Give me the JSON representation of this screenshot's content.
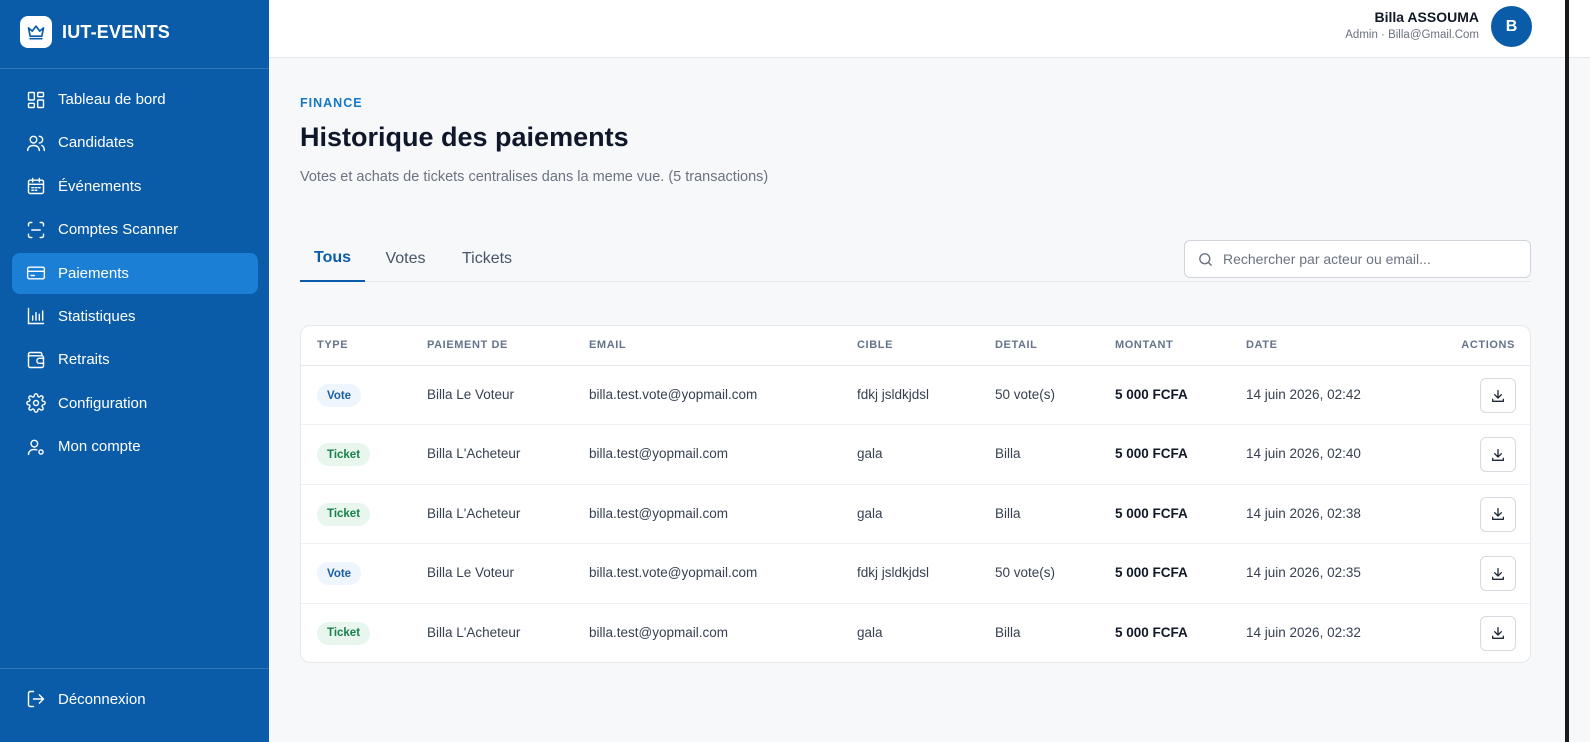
{
  "brand": {
    "name": "IUT-EVENTS",
    "icon": "crown-icon"
  },
  "sidebar": {
    "items": [
      {
        "label": "Tableau de bord",
        "icon": "dashboard-grid-icon",
        "active": false
      },
      {
        "label": "Candidates",
        "icon": "users-icon",
        "active": false
      },
      {
        "label": "Événements",
        "icon": "calendar-icon",
        "active": false
      },
      {
        "label": "Comptes Scanner",
        "icon": "scan-icon",
        "active": false
      },
      {
        "label": "Paiements",
        "icon": "credit-card-icon",
        "active": true
      },
      {
        "label": "Statistiques",
        "icon": "bar-chart-icon",
        "active": false
      },
      {
        "label": "Retraits",
        "icon": "wallet-icon",
        "active": false
      },
      {
        "label": "Configuration",
        "icon": "gear-icon",
        "active": false
      },
      {
        "label": "Mon compte",
        "icon": "user-settings-icon",
        "active": false
      }
    ],
    "logout_label": "Déconnexion"
  },
  "user": {
    "name": "Billa ASSOUMA",
    "role": "Admin · Billa@Gmail.Com",
    "initial": "B"
  },
  "page": {
    "eyebrow": "FINANCE",
    "title": "Historique des paiements",
    "subtitle": "Votes et achats de tickets centralises dans la meme vue. (5 transactions)"
  },
  "tabs": [
    {
      "label": "Tous",
      "active": true
    },
    {
      "label": "Votes",
      "active": false
    },
    {
      "label": "Tickets",
      "active": false
    }
  ],
  "search": {
    "placeholder": "Rechercher par acteur ou email...",
    "value": ""
  },
  "table": {
    "columns": [
      "TYPE",
      "PAIEMENT DE",
      "EMAIL",
      "CIBLE",
      "DETAIL",
      "MONTANT",
      "DATE",
      "ACTIONS"
    ],
    "rows": [
      {
        "type": "Vote",
        "payer": "Billa Le Voteur",
        "email": "billa.test.vote@yopmail.com",
        "target": "fdkj jsldkjdsl",
        "detail": "50 vote(s)",
        "amount": "5 000 FCFA",
        "date": "14 juin 2026, 02:42"
      },
      {
        "type": "Ticket",
        "payer": "Billa L'Acheteur",
        "email": "billa.test@yopmail.com",
        "target": "gala",
        "detail": "Billa",
        "amount": "5 000 FCFA",
        "date": "14 juin 2026, 02:40"
      },
      {
        "type": "Ticket",
        "payer": "Billa L'Acheteur",
        "email": "billa.test@yopmail.com",
        "target": "gala",
        "detail": "Billa",
        "amount": "5 000 FCFA",
        "date": "14 juin 2026, 02:38"
      },
      {
        "type": "Vote",
        "payer": "Billa Le Voteur",
        "email": "billa.test.vote@yopmail.com",
        "target": "fdkj jsldkjdsl",
        "detail": "50 vote(s)",
        "amount": "5 000 FCFA",
        "date": "14 juin 2026, 02:35"
      },
      {
        "type": "Ticket",
        "payer": "Billa L'Acheteur",
        "email": "billa.test@yopmail.com",
        "target": "gala",
        "detail": "Billa",
        "amount": "5 000 FCFA",
        "date": "14 juin 2026, 02:32"
      }
    ],
    "row_action_icon": "download-icon"
  },
  "colors": {
    "sidebar_bg": "#0a5ca8",
    "sidebar_active": "#1b7fd6",
    "accent": "#1478c6",
    "vote_badge_bg": "#eef5fd",
    "vote_badge_text": "#1b5fa6",
    "ticket_badge_bg": "#e8f6ee",
    "ticket_badge_text": "#16804a"
  }
}
